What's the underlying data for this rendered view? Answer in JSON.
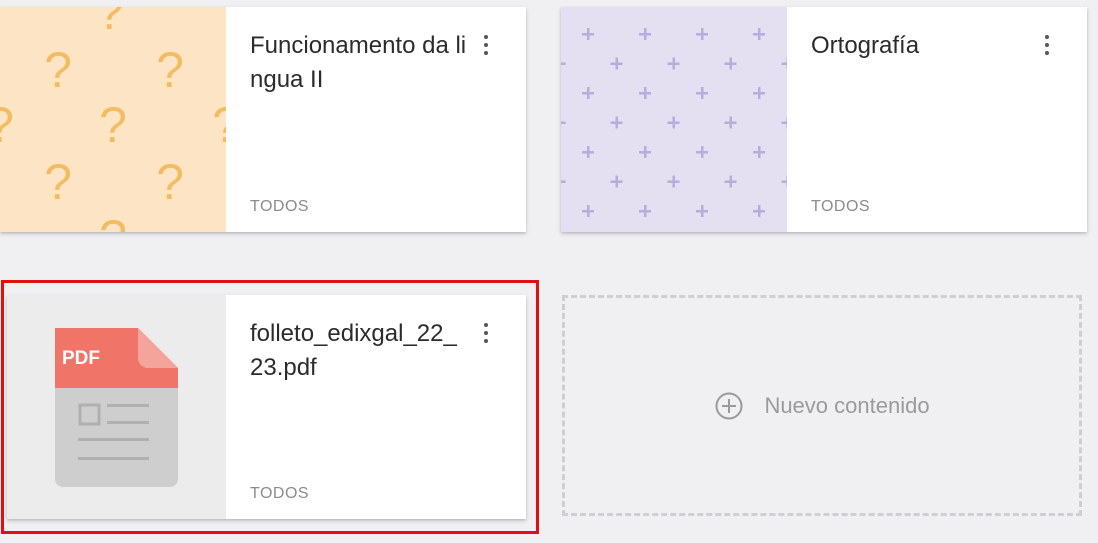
{
  "cards": [
    {
      "title": "Funcionamento da lingua II",
      "label": "TODOS",
      "thumb": "question-pattern"
    },
    {
      "title": "Ortografía",
      "label": "TODOS",
      "thumb": "plus-pattern"
    },
    {
      "title": "folleto_edixgal_22_23.pdf",
      "label": "TODOS",
      "thumb": "pdf",
      "pdf_badge": "PDF"
    }
  ],
  "new_content": {
    "label": "Nuevo contenido",
    "icon": "plus-circle-icon"
  },
  "colors": {
    "question_bg": "#fde4c4",
    "question_mark": "#f2bd62",
    "plus_bg": "#e4e0f1",
    "plus_mark": "#b7addb",
    "pdf_red": "#f07468",
    "pdf_body": "#cecece",
    "selection": "#e01010"
  }
}
